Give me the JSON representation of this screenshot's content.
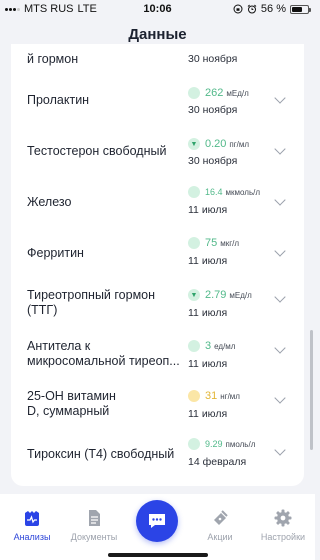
{
  "status_bar": {
    "carrier": "MTS RUS",
    "network": "LTE",
    "time": "10:06",
    "battery": "56 %"
  },
  "header": {
    "title": "Данные"
  },
  "tests": [
    {
      "name": "й гормон",
      "value": "",
      "unit": "",
      "date": "30 ноября",
      "status": "normal"
    },
    {
      "name": "Пролактин",
      "value": "262",
      "unit": "мЕд/л",
      "date": "30 ноября",
      "status": "normal"
    },
    {
      "name": "Тестостерон свободный",
      "value": "0.20",
      "unit": "пг/мл",
      "date": "30 ноября",
      "status": "low",
      "indicator": "▼"
    },
    {
      "name": "Железо",
      "value": "16.4",
      "unit": "мкмоль/л",
      "date": "11 июля",
      "status": "normal"
    },
    {
      "name": "Ферритин",
      "value": "75",
      "unit": "мкг/л",
      "date": "11 июля",
      "status": "normal"
    },
    {
      "name": "Тиреотропный гормон\n(ТТГ)",
      "value": "2.79",
      "unit": "мЕд/л",
      "date": "11 июля",
      "status": "low",
      "indicator": "▼"
    },
    {
      "name": "Антитела к\nмикросомальной тиреоп...",
      "value": "3",
      "unit": "ед/мл",
      "date": "11 июля",
      "status": "normal"
    },
    {
      "name": "25-ОН витамин\nD, суммарный",
      "value": "31",
      "unit": "нг/мл",
      "date": "11 июля",
      "status": "warning"
    },
    {
      "name": "Тироксин (Т4) свободный",
      "value": "9.29",
      "unit": "пмоль/л",
      "date": "14 февраля",
      "status": "normal"
    }
  ],
  "tabs": [
    {
      "label": "Анализы",
      "icon": "tests-icon",
      "active": true
    },
    {
      "label": "Документы",
      "icon": "document-icon",
      "active": false
    },
    {
      "label": "",
      "icon": "chat-icon",
      "active": false
    },
    {
      "label": "Акции",
      "icon": "promo-icon",
      "active": false
    },
    {
      "label": "Настройки",
      "icon": "gear-icon",
      "active": false
    }
  ],
  "colors": {
    "accent": "#2b44e6",
    "value_green": "#52b98a",
    "dot_green": "#d3f1e1",
    "dot_yellow": "#fbe6a6",
    "background": "#f2f3f7"
  }
}
